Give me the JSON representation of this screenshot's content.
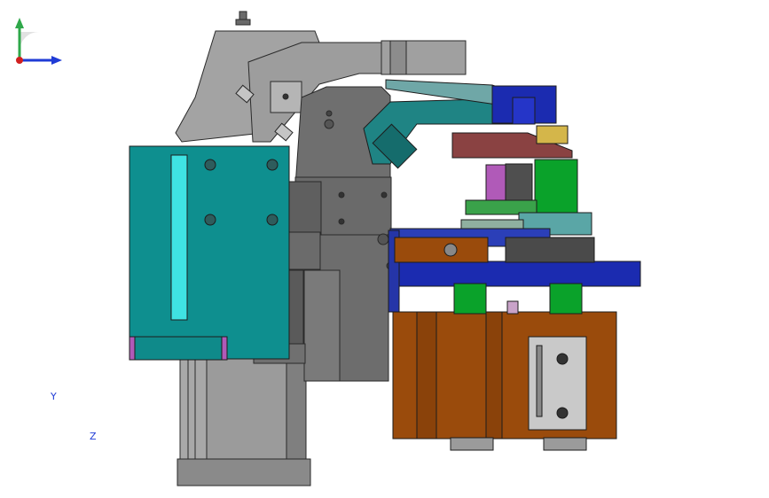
{
  "view": {
    "axes": {
      "y_label": "Y",
      "z_label": "Z",
      "y_color": "#2fa84a",
      "z_color": "#1f3bd6",
      "origin_color": "#d11f1f"
    },
    "colors": {
      "teal_block": "#0e8f8f",
      "teal_highlight": "#3fe3e3",
      "gray_body": "#9b9b9b",
      "dark_gray": "#6d6d6d",
      "arm_teal": "#1f8484",
      "navy": "#1b2bb0",
      "brown": "#9a4b0c",
      "green": "#0aa22a",
      "maroon": "#8a4242",
      "violet": "#b05ab8"
    }
  }
}
